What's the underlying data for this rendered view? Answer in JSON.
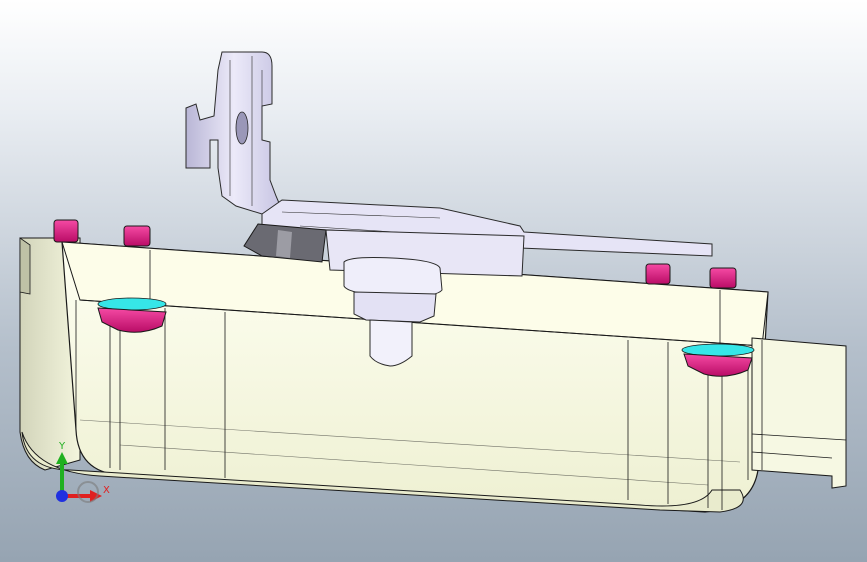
{
  "viewport": {
    "background_top": "#ffffff",
    "background_bottom": "#96a4b2"
  },
  "model": {
    "body_color": "#fbfce6",
    "edge_color": "#1a1a1a",
    "bolt_head_color": "#e0147c",
    "washer_color": "#36e6e8",
    "bracket_color": "#d7d4ee",
    "dark_part_color": "#6a6a72"
  },
  "triad": {
    "x_label": "X",
    "y_label": "Y",
    "x_color": "#e02020",
    "y_color": "#20b020",
    "z_color": "#2030e0",
    "x_icon": "x-axis-arrow-icon",
    "y_icon": "y-axis-arrow-icon",
    "origin_icon": "origin-sphere-icon"
  }
}
